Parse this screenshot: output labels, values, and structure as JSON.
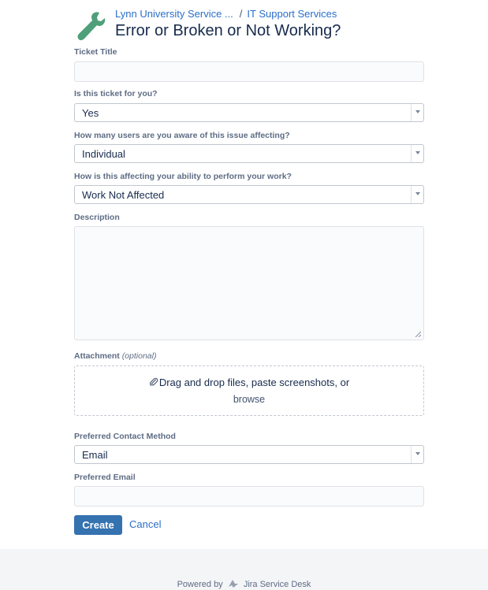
{
  "header": {
    "breadcrumb_parent": "Lynn University Service ...",
    "breadcrumb_separator": "/",
    "breadcrumb_current": "IT Support Services",
    "title": "Error or Broken or Not Working?",
    "logo_icon": "wrench-icon"
  },
  "form": {
    "ticket_title_label": "Ticket Title",
    "ticket_title_value": "",
    "for_you_label": "Is this ticket for you?",
    "for_you_value": "Yes",
    "users_label": "How many users are you aware of this issue affecting?",
    "users_value": "Individual",
    "impact_label": "How is this affecting your ability to perform your work?",
    "impact_value": "Work Not Affected",
    "description_label": "Description",
    "description_value": "",
    "attachment_label": "Attachment",
    "attachment_optional": "(optional)",
    "dropzone_text": "Drag and drop files, paste screenshots, or",
    "dropzone_browse": "browse",
    "contact_label": "Preferred Contact Method",
    "contact_value": "Email",
    "email_label": "Preferred Email",
    "email_value": ""
  },
  "actions": {
    "create_label": "Create",
    "cancel_label": "Cancel"
  },
  "footer": {
    "powered_prefix": "Powered by",
    "product_name": "Jira Service Desk"
  },
  "colors": {
    "accent": "#3572b0",
    "link": "#2a6fc9",
    "logo_green": "#4fa07a"
  }
}
